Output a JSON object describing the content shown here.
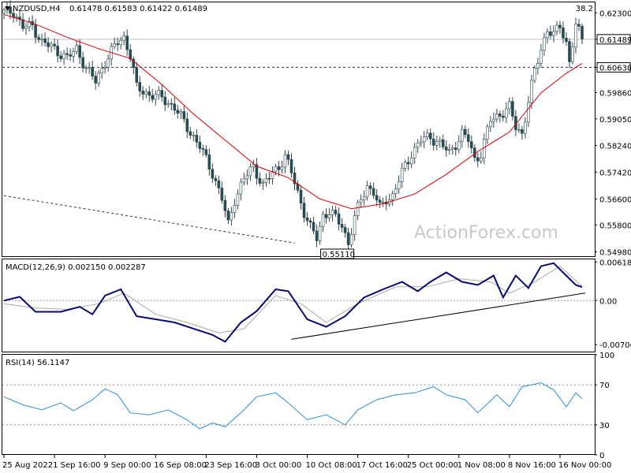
{
  "chart_data": [
    {
      "type": "candlestick",
      "title": "NZDUSD,H4",
      "ohlc_header": [
        "0.61478",
        "0.61583",
        "0.61422",
        "0.61489"
      ],
      "top_right_value": "38.2",
      "watermark": "ActionForex.com",
      "y_ticks": [
        "0.62300",
        "0.61489",
        "0.60630",
        "0.59860",
        "0.59050",
        "0.58240",
        "0.57420",
        "0.56600",
        "0.55800",
        "0.54980"
      ],
      "y_tick_values": [
        0.623,
        0.61489,
        0.6063,
        0.5986,
        0.5905,
        0.5824,
        0.5742,
        0.566,
        0.558,
        0.5498
      ],
      "ylim": [
        0.5482,
        0.6262
      ],
      "current_price_label": "0.61489",
      "level_label": "0.60630",
      "level": 0.6063,
      "low_annotation": "0.55110",
      "low_annotation_value": 0.5511,
      "price_path": [
        [
          0,
          0.623
        ],
        [
          3,
          0.6235
        ],
        [
          6,
          0.6185
        ],
        [
          9,
          0.619
        ],
        [
          12,
          0.614
        ],
        [
          16,
          0.612
        ],
        [
          20,
          0.609
        ],
        [
          23,
          0.612
        ],
        [
          26,
          0.606
        ],
        [
          29,
          0.602
        ],
        [
          32,
          0.608
        ],
        [
          36,
          0.614
        ],
        [
          38,
          0.6155
        ],
        [
          40,
          0.61
        ],
        [
          42,
          0.6
        ],
        [
          46,
          0.598
        ],
        [
          50,
          0.597
        ],
        [
          54,
          0.594
        ],
        [
          58,
          0.588
        ],
        [
          62,
          0.582
        ],
        [
          66,
          0.574
        ],
        [
          69,
          0.566
        ],
        [
          71,
          0.558
        ],
        [
          73,
          0.566
        ],
        [
          76,
          0.572
        ],
        [
          79,
          0.576
        ],
        [
          82,
          0.57
        ],
        [
          85,
          0.574
        ],
        [
          87,
          0.576
        ],
        [
          89,
          0.579
        ],
        [
          91,
          0.574
        ],
        [
          93,
          0.568
        ],
        [
          95,
          0.562
        ],
        [
          97,
          0.557
        ],
        [
          99,
          0.554
        ],
        [
          101,
          0.561
        ],
        [
          103,
          0.562
        ],
        [
          105,
          0.56
        ],
        [
          107,
          0.558
        ],
        [
          109,
          0.5525
        ],
        [
          111,
          0.56
        ],
        [
          113,
          0.566
        ],
        [
          115,
          0.57
        ],
        [
          117,
          0.568
        ],
        [
          119,
          0.563
        ],
        [
          121,
          0.566
        ],
        [
          123,
          0.567
        ],
        [
          126,
          0.574
        ],
        [
          129,
          0.58
        ],
        [
          132,
          0.584
        ],
        [
          135,
          0.585
        ],
        [
          138,
          0.583
        ],
        [
          141,
          0.58
        ],
        [
          143,
          0.583
        ],
        [
          145,
          0.586
        ],
        [
          147,
          0.584
        ],
        [
          149,
          0.578
        ],
        [
          151,
          0.58
        ],
        [
          154,
          0.59
        ],
        [
          157,
          0.592
        ],
        [
          160,
          0.594
        ],
        [
          162,
          0.588
        ],
        [
          164,
          0.586
        ],
        [
          166,
          0.596
        ],
        [
          168,
          0.605
        ],
        [
          170,
          0.612
        ],
        [
          172,
          0.618
        ],
        [
          174,
          0.616
        ],
        [
          176,
          0.619
        ],
        [
          178,
          0.614
        ],
        [
          179,
          0.608
        ],
        [
          181,
          0.619
        ],
        [
          183,
          0.6149
        ]
      ],
      "ma_path": [
        [
          0,
          0.6225
        ],
        [
          10,
          0.6195
        ],
        [
          20,
          0.6155
        ],
        [
          30,
          0.612
        ],
        [
          40,
          0.609
        ],
        [
          50,
          0.601
        ],
        [
          60,
          0.592
        ],
        [
          70,
          0.584
        ],
        [
          80,
          0.576
        ],
        [
          90,
          0.5725
        ],
        [
          100,
          0.566
        ],
        [
          110,
          0.563
        ],
        [
          120,
          0.5645
        ],
        [
          130,
          0.5675
        ],
        [
          140,
          0.5735
        ],
        [
          150,
          0.5805
        ],
        [
          160,
          0.5865
        ],
        [
          170,
          0.5985
        ],
        [
          178,
          0.6045
        ],
        [
          183,
          0.6075
        ]
      ],
      "trendline_start": [
        0,
        0.567
      ],
      "trendline_end": [
        92,
        0.5525
      ],
      "x_labels": [
        "25 Aug 2022",
        "1 Sep 16:00",
        "9 Sep 00:00",
        "16 Sep 08:00",
        "23 Sep 16:00",
        "3 Oct 00:00",
        "10 Oct 08:00",
        "17 Oct 16:00",
        "25 Oct 00:00",
        "1 Nov 08:00",
        "8 Nov 16:00",
        "16 Nov 00:00"
      ],
      "x_label_index": [
        0,
        16,
        32,
        48,
        64,
        80,
        96,
        112,
        128,
        144,
        160,
        176
      ],
      "n_bars": 184,
      "colors": {
        "candle": "#2b4a4f",
        "ma": "#d90000",
        "level_line": "#333333",
        "trendline": "#333333"
      }
    },
    {
      "type": "line",
      "title": "MACD(12,26,9) 0.002150 0.002287",
      "y_ticks": [
        "0.006188",
        "0.00",
        "-0.007068"
      ],
      "y_tick_values": [
        0.006188,
        0.0,
        -0.007068
      ],
      "ylim": [
        -0.0083,
        0.0066
      ],
      "macd_path": [
        [
          0,
          0.0
        ],
        [
          5,
          0.0006
        ],
        [
          10,
          -0.0018
        ],
        [
          18,
          -0.0018
        ],
        [
          24,
          -0.001
        ],
        [
          28,
          -0.0022
        ],
        [
          32,
          0.0008
        ],
        [
          37,
          0.0018
        ],
        [
          42,
          -0.0025
        ],
        [
          48,
          -0.003
        ],
        [
          54,
          -0.0035
        ],
        [
          60,
          -0.0045
        ],
        [
          66,
          -0.0055
        ],
        [
          70,
          -0.0066
        ],
        [
          75,
          -0.0035
        ],
        [
          80,
          -0.0017
        ],
        [
          86,
          0.0018
        ],
        [
          90,
          0.0015
        ],
        [
          96,
          -0.003
        ],
        [
          102,
          -0.0042
        ],
        [
          108,
          -0.0025
        ],
        [
          114,
          0.0005
        ],
        [
          120,
          0.0018
        ],
        [
          126,
          0.003
        ],
        [
          131,
          0.0015
        ],
        [
          135,
          0.003
        ],
        [
          140,
          0.0045
        ],
        [
          145,
          0.003
        ],
        [
          150,
          0.0025
        ],
        [
          155,
          0.004
        ],
        [
          158,
          0.0005
        ],
        [
          162,
          0.004
        ],
        [
          166,
          0.002
        ],
        [
          170,
          0.0055
        ],
        [
          174,
          0.006
        ],
        [
          178,
          0.004
        ],
        [
          181,
          0.0025
        ],
        [
          183,
          0.00215
        ]
      ],
      "signal_path": [
        [
          0,
          -0.0005
        ],
        [
          10,
          -0.0012
        ],
        [
          20,
          -0.0014
        ],
        [
          30,
          -0.0005
        ],
        [
          38,
          0.0012
        ],
        [
          48,
          -0.0022
        ],
        [
          58,
          -0.0035
        ],
        [
          68,
          -0.0052
        ],
        [
          76,
          -0.0045
        ],
        [
          86,
          0.0008
        ],
        [
          94,
          -0.0005
        ],
        [
          102,
          -0.0035
        ],
        [
          112,
          -0.0005
        ],
        [
          124,
          0.0022
        ],
        [
          134,
          0.0022
        ],
        [
          144,
          0.0035
        ],
        [
          154,
          0.003
        ],
        [
          160,
          0.0012
        ],
        [
          168,
          0.003
        ],
        [
          176,
          0.0055
        ],
        [
          183,
          0.0023
        ]
      ],
      "trendline_start": [
        91,
        -0.0062
      ],
      "trendline_end": [
        184,
        0.0012
      ],
      "colors": {
        "macd": "#0a0a6e",
        "signal": "#aaaaaa",
        "trendline": "#000000"
      }
    },
    {
      "type": "line",
      "title": "RSI(14) 56.1147",
      "y_ticks": [
        "100",
        "70",
        "30",
        "0"
      ],
      "y_tick_values": [
        100,
        70,
        30,
        0
      ],
      "ylim": [
        0,
        100
      ],
      "levels": [
        70,
        30
      ],
      "rsi_path": [
        [
          0,
          58
        ],
        [
          6,
          50
        ],
        [
          12,
          45
        ],
        [
          18,
          52
        ],
        [
          22,
          44
        ],
        [
          28,
          55
        ],
        [
          32,
          66
        ],
        [
          36,
          60
        ],
        [
          40,
          42
        ],
        [
          46,
          40
        ],
        [
          52,
          45
        ],
        [
          58,
          35
        ],
        [
          62,
          26
        ],
        [
          66,
          32
        ],
        [
          70,
          28
        ],
        [
          76,
          45
        ],
        [
          80,
          58
        ],
        [
          86,
          62
        ],
        [
          90,
          52
        ],
        [
          96,
          35
        ],
        [
          102,
          40
        ],
        [
          108,
          30
        ],
        [
          112,
          45
        ],
        [
          118,
          55
        ],
        [
          124,
          60
        ],
        [
          130,
          62
        ],
        [
          136,
          68
        ],
        [
          140,
          60
        ],
        [
          146,
          55
        ],
        [
          150,
          42
        ],
        [
          156,
          60
        ],
        [
          160,
          48
        ],
        [
          164,
          68
        ],
        [
          170,
          72
        ],
        [
          174,
          65
        ],
        [
          178,
          48
        ],
        [
          181,
          62
        ],
        [
          183,
          56
        ]
      ],
      "colors": {
        "rsi": "#2c8ed6",
        "level_line": "#888888"
      }
    }
  ]
}
